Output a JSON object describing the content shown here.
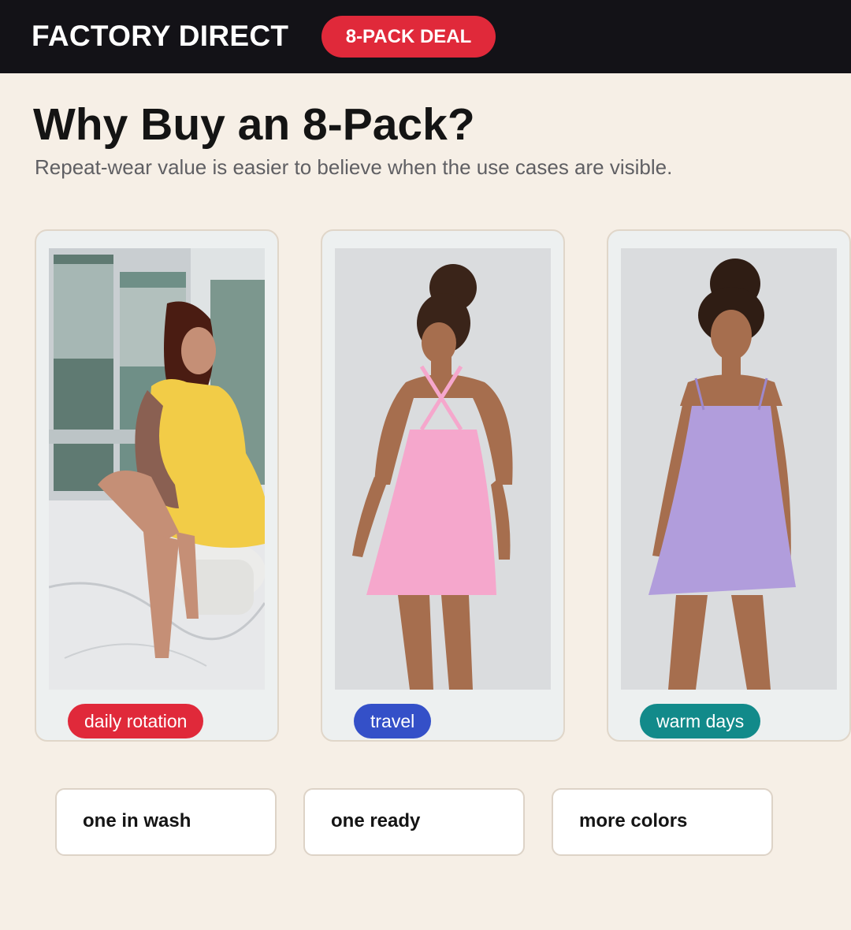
{
  "header": {
    "brand": "FACTORY DIRECT",
    "badge": "8-PACK DEAL"
  },
  "hero": {
    "title": "Why Buy an 8-Pack?",
    "subtitle": "Repeat-wear value is easier to believe when the use cases are visible."
  },
  "cards": [
    {
      "tag": "daily rotation",
      "tag_color": "#e0293a",
      "photo": "woman in yellow dress seated by window",
      "dress_color": "#f2cc47"
    },
    {
      "tag": "travel",
      "tag_color": "#3450c8",
      "photo": "woman in pink dress, back view",
      "dress_color": "#f5a7cc"
    },
    {
      "tag": "warm days",
      "tag_color": "#128a8a",
      "photo": "woman in lavender dress, front view",
      "dress_color": "#b19ddc"
    }
  ],
  "benefits": [
    "one in wash",
    "one ready",
    "more colors"
  ],
  "colors": {
    "topbar": "#131217",
    "background": "#f6efe6",
    "accent_red": "#e0293a"
  }
}
